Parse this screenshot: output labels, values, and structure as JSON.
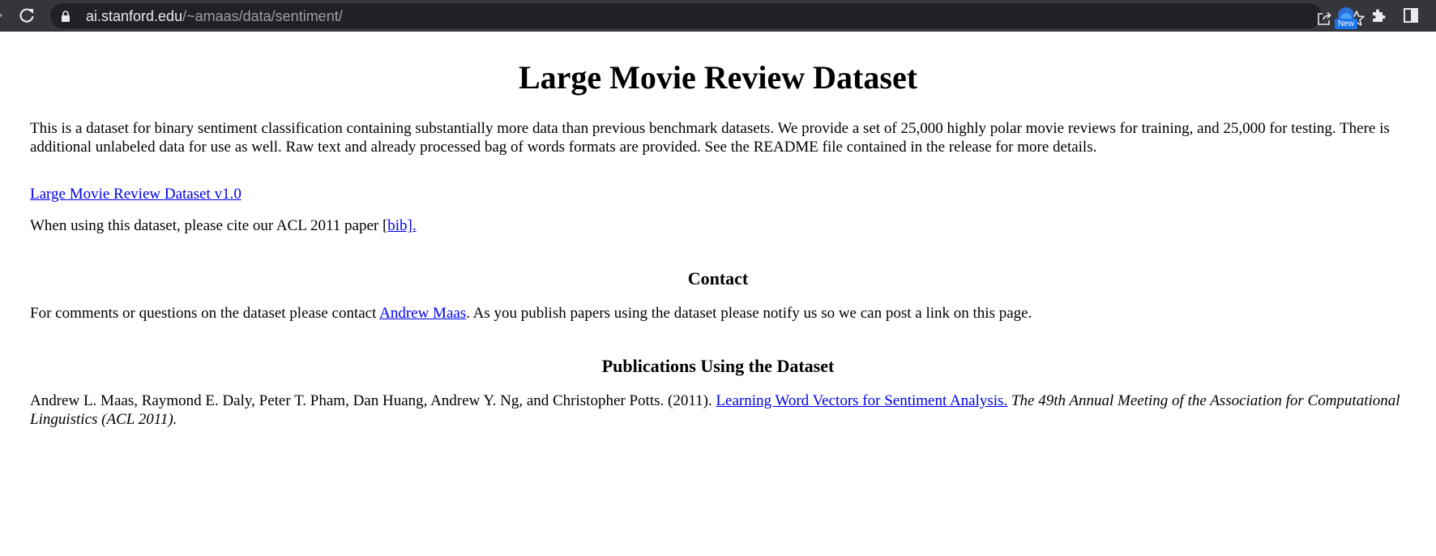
{
  "browser": {
    "url_host": "ai.stanford.edu",
    "url_path": "/~amaas/data/sentiment/",
    "extension_badge": "New",
    "icons": [
      "forward-icon",
      "reload-icon",
      "lock-icon",
      "share-icon",
      "star-icon",
      "extension-new-icon",
      "puzzle-icon",
      "side-panel-icon"
    ]
  },
  "page": {
    "title": "Large Movie Review Dataset",
    "intro": "This is a dataset for binary sentiment classification containing substantially more data than previous benchmark datasets. We provide a set of 25,000 highly polar movie reviews for training, and 25,000 for testing. There is additional unlabeled data for use as well. Raw text and already processed bag of words formats are provided. See the README file contained in the release for more details.",
    "download_link": "Large Movie Review Dataset v1.0",
    "cite_text": "When using this dataset, please cite our ACL 2011 paper ",
    "cite_open": "[",
    "bib_link": "bib].",
    "contact": {
      "heading": "Contact",
      "text_before": "For comments or questions on the dataset please contact ",
      "link": "Andrew Maas",
      "text_after": ". As you publish papers using the dataset please notify us so we can post a link on this page."
    },
    "publications": {
      "heading": "Publications Using the Dataset",
      "authors": "Andrew L. Maas, Raymond E. Daly, Peter T. Pham, Dan Huang, Andrew Y. Ng, and Christopher Potts. (2011). ",
      "paper_link": "Learning Word Vectors for Sentiment Analysis.",
      "venue": " The 49th Annual Meeting of the Association for Computational Linguistics (ACL 2011)."
    }
  },
  "colors": {
    "toolbar": "#35363a",
    "omnibox": "#202124",
    "link": "#0000ee",
    "badge": "#1a73e8"
  }
}
